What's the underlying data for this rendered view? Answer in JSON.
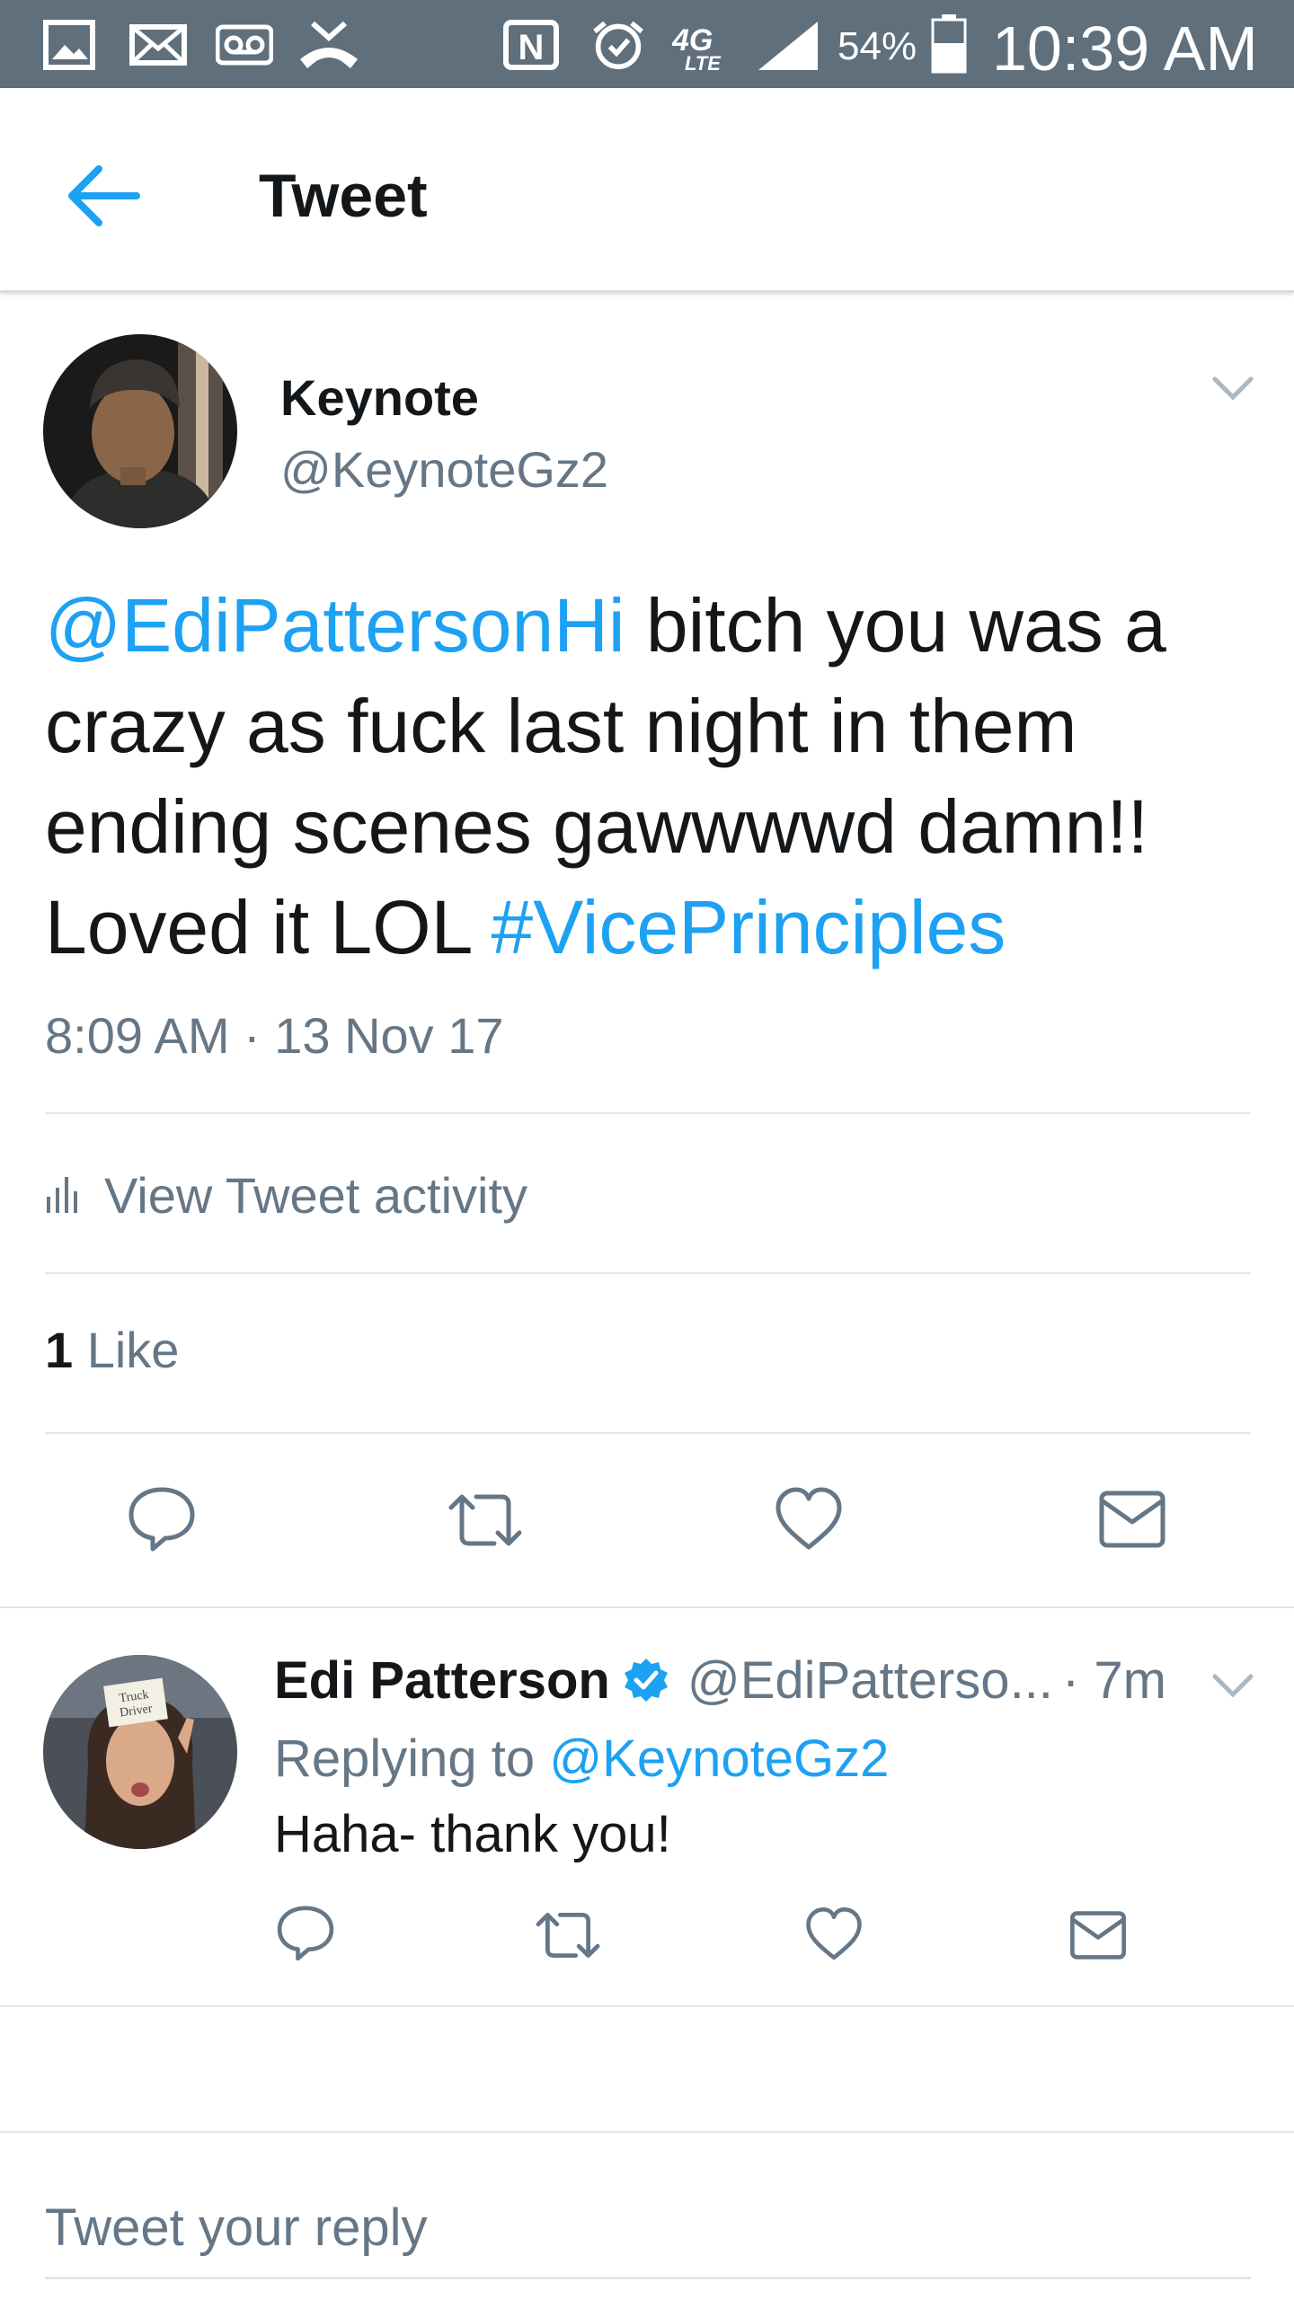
{
  "status_bar": {
    "network": "4G LTE",
    "battery": "54%",
    "time": "10:39 AM",
    "icons": [
      "gallery-icon",
      "mail-icon",
      "voicemail-icon",
      "missed-call-icon",
      "nfc-icon",
      "alarm-icon",
      "network-4g-icon",
      "signal-icon",
      "battery-icon"
    ]
  },
  "header": {
    "title": "Tweet",
    "back_icon": "arrow-left-icon"
  },
  "tweet": {
    "author_name": "Keynote",
    "author_handle": "@KeynoteGz2",
    "mention": "@EdiPattersonHi",
    "text_line1": " bitch you was a",
    "text_line2": "crazy as fuck last night in them",
    "text_line3": "ending scenes gawwwwd damn!!",
    "text_line4": "Loved it LOL ",
    "hashtag": "#VicePrinciples",
    "timestamp": "8:09 AM · 13 Nov 17",
    "activity_label": "View Tweet activity",
    "like_count": "1",
    "like_label": " Like"
  },
  "reply": {
    "author_name": "Edi Patterson",
    "author_handle": "@EdiPatterso...",
    "time": " · 7m",
    "replying_prefix": "Replying to ",
    "replying_handle": "@KeynoteGz2",
    "text": "Haha- thank you!",
    "avatar_sign_text": "Truck Driver"
  },
  "composer": {
    "placeholder": "Tweet your reply"
  },
  "colors": {
    "status_bar": "#5f6f7c",
    "link": "#1da1f2",
    "secondary_text": "#657786",
    "divider": "#e1e8ed"
  }
}
